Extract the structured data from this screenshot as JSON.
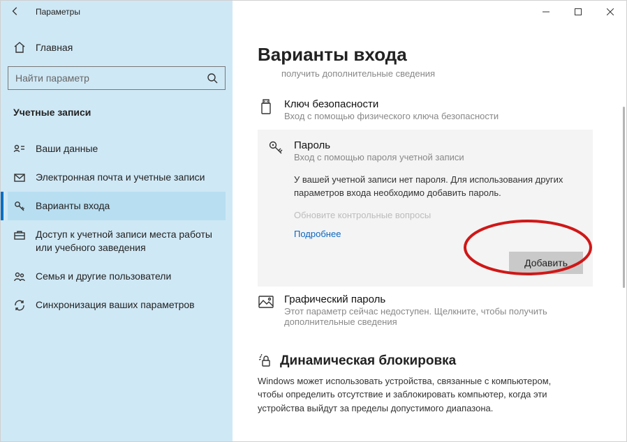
{
  "window": {
    "title": "Параметры",
    "minimize": "—",
    "maximize": "□",
    "close": "✕"
  },
  "sidebar": {
    "home_label": "Главная",
    "search_placeholder": "Найти параметр",
    "section_label": "Учетные записи",
    "items": [
      {
        "id": "your-info",
        "label": "Ваши данные"
      },
      {
        "id": "email-accounts",
        "label": "Электронная почта и учетные записи"
      },
      {
        "id": "signin-options",
        "label": "Варианты входа",
        "selected": true
      },
      {
        "id": "work-school",
        "label": "Доступ к учетной записи места работы или учебного заведения"
      },
      {
        "id": "family",
        "label": "Семья и другие пользователи"
      },
      {
        "id": "sync",
        "label": "Синхронизация ваших параметров"
      }
    ]
  },
  "main": {
    "title": "Варианты входа",
    "top_link": "получить дополнительные сведения",
    "security_key": {
      "title": "Ключ безопасности",
      "subtitle": "Вход с помощью физического ключа безопасности"
    },
    "password": {
      "title": "Пароль",
      "subtitle": "Вход с помощью пароля учетной записи",
      "description": "У вашей учетной записи нет пароля. Для использования других параметров входа необходимо добавить пароль.",
      "disabled_link": "Обновите контрольные вопросы",
      "more_link": "Подробнее",
      "add_button": "Добавить"
    },
    "picture_password": {
      "title": "Графический пароль",
      "subtitle": "Этот параметр сейчас недоступен. Щелкните, чтобы получить дополнительные сведения"
    },
    "dynamic_lock": {
      "heading": "Динамическая блокировка",
      "description": "Windows может использовать устройства, связанные с компьютером, чтобы определить отсутствие и заблокировать компьютер, когда эти устройства выйдут за пределы допустимого диапазона."
    }
  }
}
